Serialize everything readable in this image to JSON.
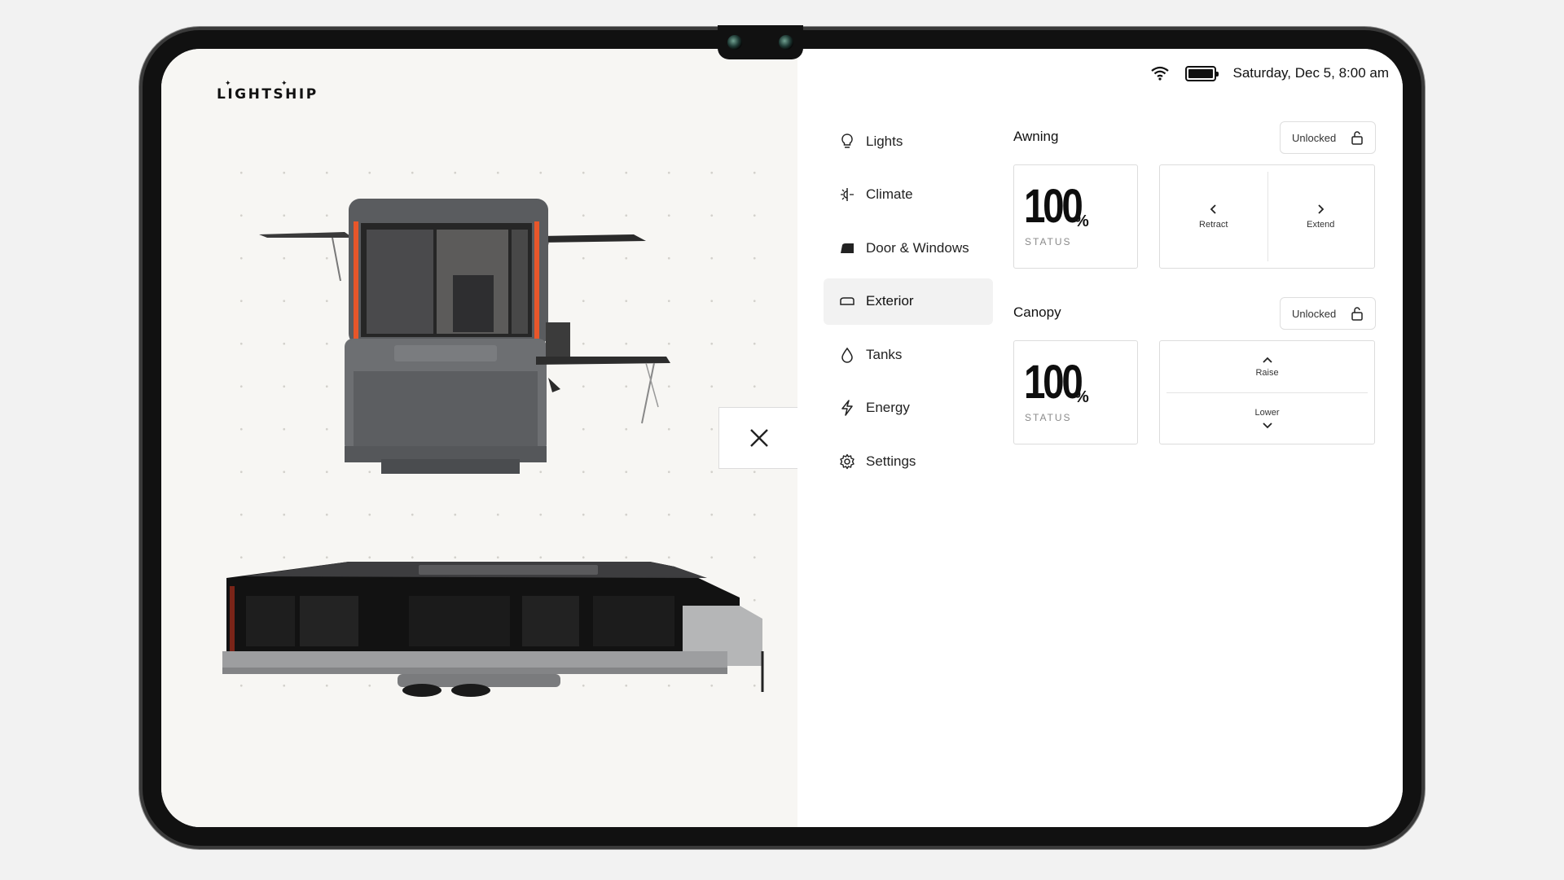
{
  "brand": {
    "logo_text": "LIGHTSHIP"
  },
  "status_bar": {
    "datetime": "Saturday, Dec 5, 8:00 am",
    "wifi_icon": "wifi-icon",
    "battery_icon": "battery-icon"
  },
  "nav": {
    "items": [
      {
        "label": "Lights",
        "icon": "lightbulb-icon"
      },
      {
        "label": "Climate",
        "icon": "climate-icon"
      },
      {
        "label": "Door & Windows",
        "icon": "door-icon"
      },
      {
        "label": "Exterior",
        "icon": "exterior-icon",
        "active": true
      },
      {
        "label": "Tanks",
        "icon": "water-drop-icon"
      },
      {
        "label": "Energy",
        "icon": "bolt-icon"
      },
      {
        "label": "Settings",
        "icon": "gear-icon"
      }
    ]
  },
  "awning": {
    "title": "Awning",
    "lock_label": "Unlocked",
    "value": "100",
    "unit": "%",
    "status_label": "STATUS",
    "retract_label": "Retract",
    "extend_label": "Extend"
  },
  "canopy": {
    "title": "Canopy",
    "lock_label": "Unlocked",
    "value": "100",
    "unit": "%",
    "status_label": "STATUS",
    "raise_label": "Raise",
    "lower_label": "Lower"
  },
  "colors": {
    "accent_orange": "#e8562a",
    "background": "#f7f6f3"
  }
}
